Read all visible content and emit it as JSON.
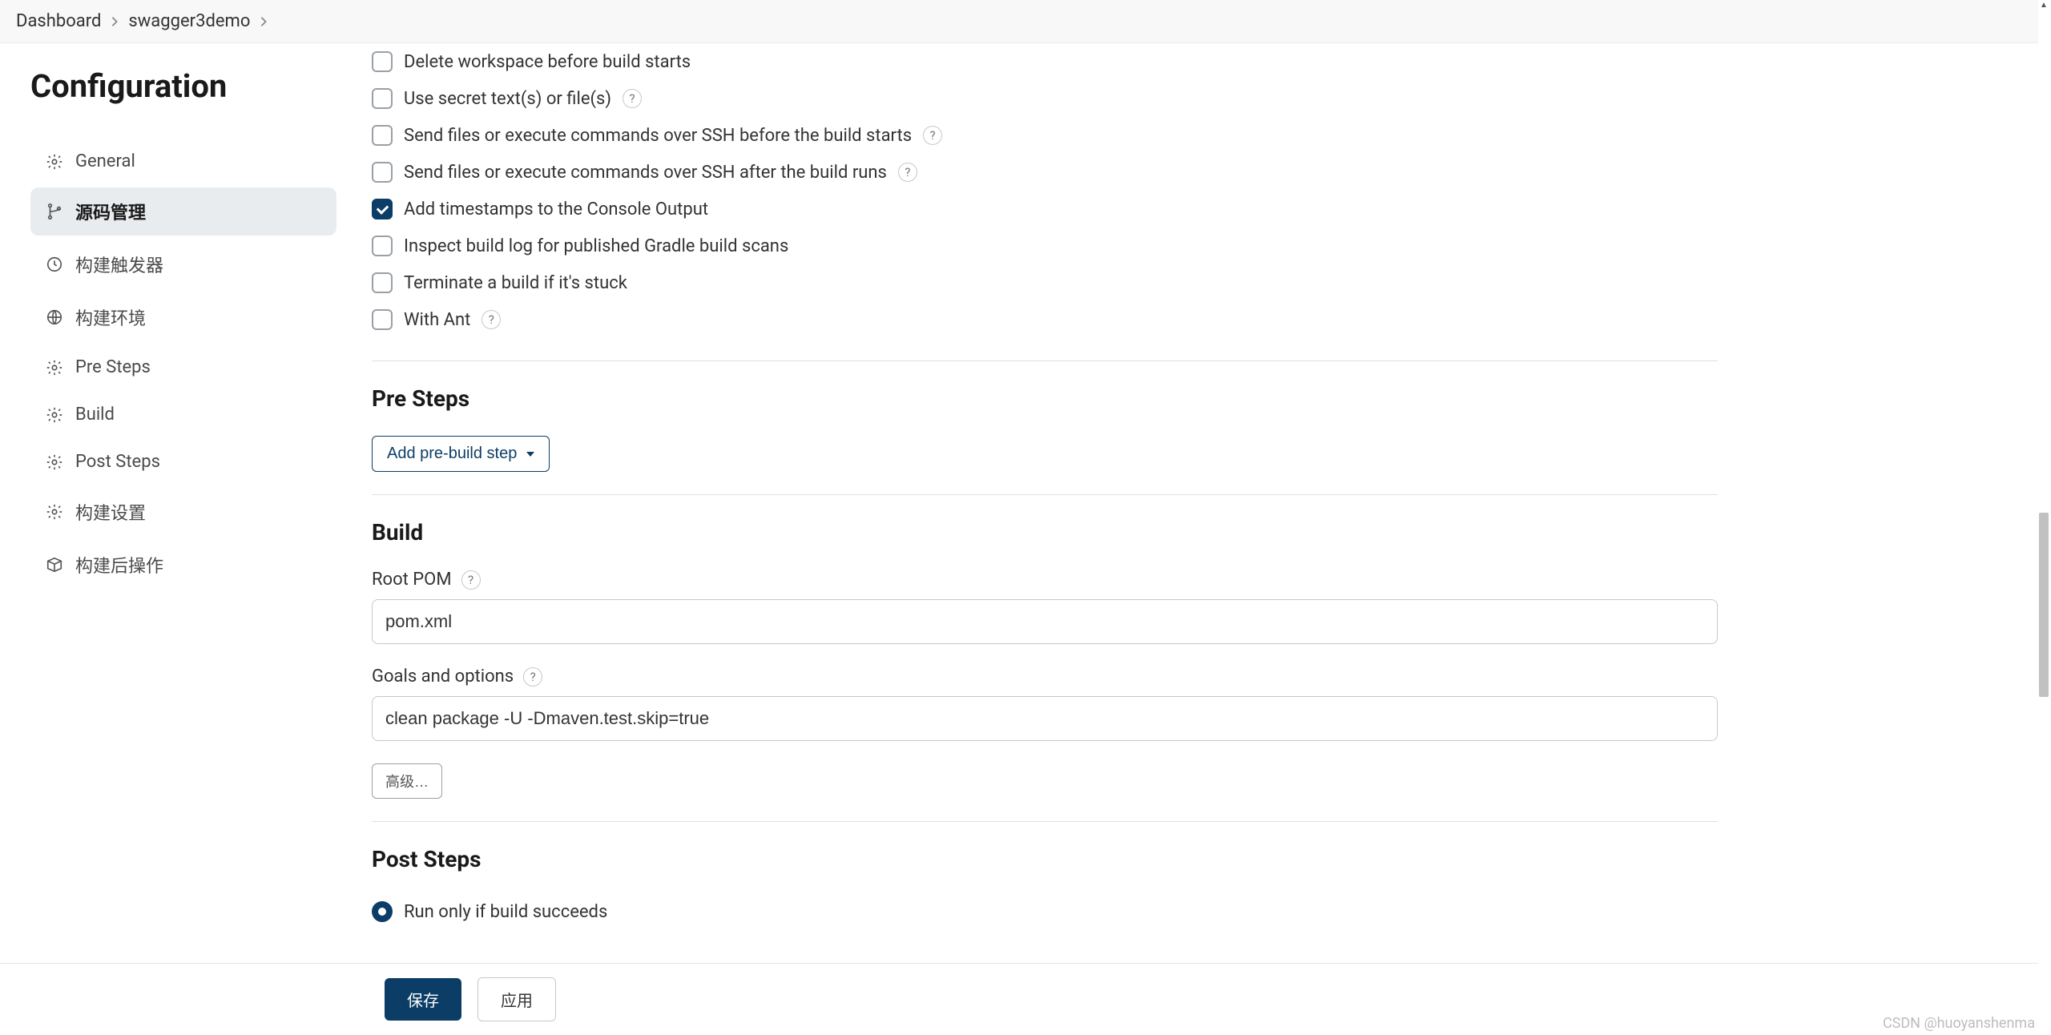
{
  "breadcrumb": {
    "items": [
      "Dashboard",
      "swagger3demo"
    ]
  },
  "page_title": "Configuration",
  "sidebar": {
    "items": [
      {
        "label": "General",
        "icon": "gear"
      },
      {
        "label": "源码管理",
        "icon": "branch"
      },
      {
        "label": "构建触发器",
        "icon": "clock"
      },
      {
        "label": "构建环境",
        "icon": "globe"
      },
      {
        "label": "Pre Steps",
        "icon": "gear"
      },
      {
        "label": "Build",
        "icon": "gear"
      },
      {
        "label": "Post Steps",
        "icon": "gear"
      },
      {
        "label": "构建设置",
        "icon": "gear"
      },
      {
        "label": "构建后操作",
        "icon": "box"
      }
    ],
    "active_index": 1
  },
  "env_section": {
    "options": [
      {
        "label": "Delete workspace before build starts",
        "checked": false,
        "help": false
      },
      {
        "label": "Use secret text(s) or file(s)",
        "checked": false,
        "help": true
      },
      {
        "label": "Send files or execute commands over SSH before the build starts",
        "checked": false,
        "help": true
      },
      {
        "label": "Send files or execute commands over SSH after the build runs",
        "checked": false,
        "help": true
      },
      {
        "label": "Add timestamps to the Console Output",
        "checked": true,
        "help": false
      },
      {
        "label": "Inspect build log for published Gradle build scans",
        "checked": false,
        "help": false
      },
      {
        "label": "Terminate a build if it's stuck",
        "checked": false,
        "help": false
      },
      {
        "label": "With Ant",
        "checked": false,
        "help": true
      }
    ]
  },
  "pre_steps": {
    "title": "Pre Steps",
    "add_button": "Add pre-build step"
  },
  "build": {
    "title": "Build",
    "root_pom_label": "Root POM",
    "root_pom_value": "pom.xml",
    "goals_label": "Goals and options",
    "goals_value": "clean package -U -Dmaven.test.skip=true",
    "advanced_button": "高级…"
  },
  "post_steps": {
    "title": "Post Steps",
    "radio_label": "Run only if build succeeds"
  },
  "actions": {
    "save": "保存",
    "apply": "应用"
  },
  "help_char": "?",
  "watermark": "CSDN @huoyanshenma"
}
